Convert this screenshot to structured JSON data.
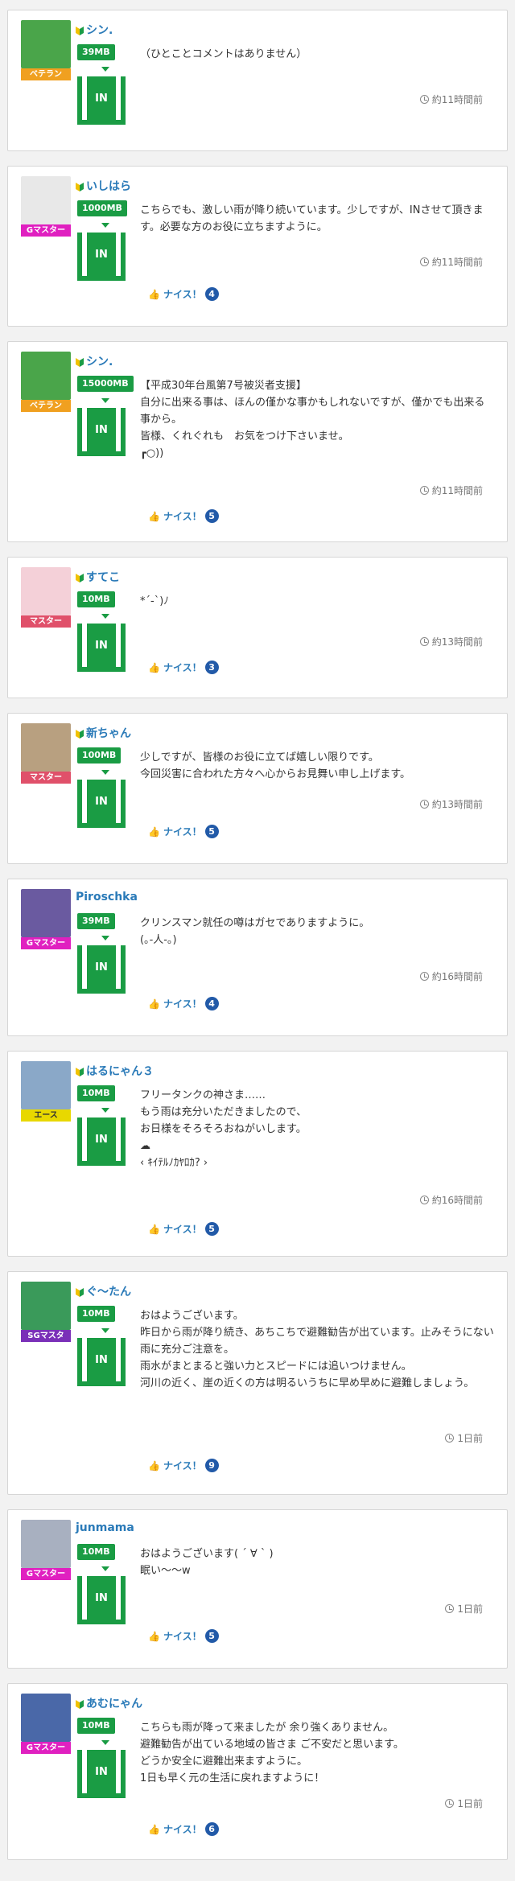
{
  "feed": [
    {
      "name": "シン.",
      "beginner_mark": true,
      "rank": "ベテラン",
      "rank_color": "#f0a020",
      "avatar_color": "#4aa54a",
      "mb": "39MB",
      "in_label": "IN",
      "lines": [
        "（ひとことコメントはありません）"
      ],
      "time": "約11時間前",
      "nice_label": null,
      "nice_count": null
    },
    {
      "name": "いしはら",
      "beginner_mark": true,
      "rank": "Gマスター",
      "rank_color": "#e020c0",
      "avatar_color": "#e8e8e8",
      "mb": "1000MB",
      "in_label": "IN",
      "lines": [
        "こちらでも、激しい雨が降り続いています。少しですが、INさせて頂きます。必要な方のお役に立ちますように。"
      ],
      "time": "約11時間前",
      "nice_label": "ナイス！",
      "nice_count": "4"
    },
    {
      "name": "シン.",
      "beginner_mark": true,
      "rank": "ベテラン",
      "rank_color": "#f0a020",
      "avatar_color": "#4aa54a",
      "mb": "15000MB",
      "in_label": "IN",
      "lines": [
        "【平成30年台風第7号被災者支援】",
        "自分に出来る事は、ほんの僅かな事かもしれないですが、僅かでも出来る事から。",
        "皆様、くれぐれも　お気をつけ下さいませ。",
        "┏○))"
      ],
      "time": "約11時間前",
      "nice_label": "ナイス！",
      "nice_count": "5"
    },
    {
      "name": "すてこ",
      "beginner_mark": true,
      "rank": "マスター",
      "rank_color": "#e0506a",
      "avatar_color": "#f4d0d8",
      "mb": "10MB",
      "in_label": "IN",
      "lines": [
        "*´-`)ﾉ"
      ],
      "time": "約13時間前",
      "nice_label": "ナイス！",
      "nice_count": "3"
    },
    {
      "name": "新ちゃん",
      "beginner_mark": true,
      "rank": "マスター",
      "rank_color": "#e0506a",
      "avatar_color": "#b8a080",
      "mb": "100MB",
      "in_label": "IN",
      "lines": [
        "少しですが、皆様のお役に立てば嬉しい限りです。",
        "今回災害に合われた方々へ心からお見舞い申し上げます。"
      ],
      "time": "約13時間前",
      "nice_label": "ナイス！",
      "nice_count": "5"
    },
    {
      "name": "Piroschka",
      "beginner_mark": false,
      "rank": "Gマスター",
      "rank_color": "#e020c0",
      "avatar_color": "#6a5aa0",
      "mb": "39MB",
      "in_label": "IN",
      "lines": [
        "クリンスマン就任の噂はガセでありますように。",
        "(｡-人-｡)"
      ],
      "time": "約16時間前",
      "nice_label": "ナイス！",
      "nice_count": "4"
    },
    {
      "name": "はるにゃん３",
      "beginner_mark": true,
      "rank": "エース",
      "rank_color": "#e8d800",
      "avatar_color": "#8aa8c8",
      "mb": "10MB",
      "in_label": "IN",
      "lines": [
        "フリータンクの神さま……",
        "もう雨は充分いただきましたので、",
        "お日様をそろそろおねがいします。",
        "☁",
        "‹ ｷｲﾃﾙﾉｶﾔﾛｶ? ›"
      ],
      "time": "約16時間前",
      "nice_label": "ナイス！",
      "nice_count": "5"
    },
    {
      "name": "ぐ～たん",
      "beginner_mark": true,
      "rank": "SGマスタ",
      "rank_color": "#7a30b8",
      "avatar_color": "#3a9a5a",
      "mb": "10MB",
      "in_label": "IN",
      "lines": [
        "おはようございます。",
        "昨日から雨が降り続き、あちこちで避難勧告が出ています。止みそうにない雨に充分ご注意を。",
        "雨水がまとまると強い力とスピードには追いつけません。",
        "河川の近く、崖の近くの方は明るいうちに早め早めに避難しましょう。"
      ],
      "time": "1日前",
      "nice_label": "ナイス！",
      "nice_count": "9"
    },
    {
      "name": "junmama",
      "beginner_mark": false,
      "rank": "Gマスター",
      "rank_color": "#e020c0",
      "avatar_color": "#a8b0c0",
      "mb": "10MB",
      "in_label": "IN",
      "lines": [
        "おはようございます( ´ ∀ ` )",
        "眠い～～w"
      ],
      "time": "1日前",
      "nice_label": "ナイス！",
      "nice_count": "5"
    },
    {
      "name": "あむにゃん",
      "beginner_mark": true,
      "rank": "Gマスター",
      "rank_color": "#e020c0",
      "avatar_color": "#4a68a8",
      "mb": "10MB",
      "in_label": "IN",
      "lines": [
        "こちらも雨が降って来ましたが 余り強くありません。",
        "避難勧告が出ている地域の皆さま ご不安だと思います。",
        "どうか安全に避難出来ますように。",
        "1日も早く元の生活に戻れますように！"
      ],
      "time": "1日前",
      "nice_label": "ナイス！",
      "nice_count": "6"
    }
  ]
}
